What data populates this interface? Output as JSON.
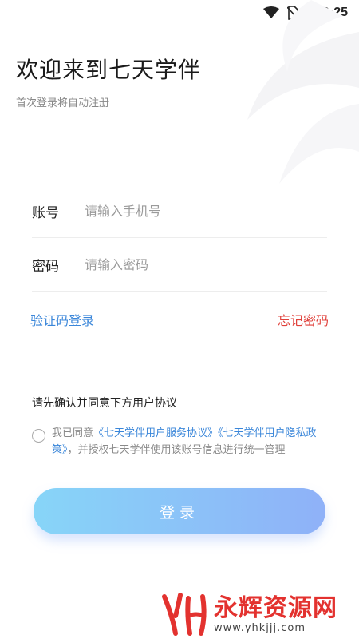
{
  "status_bar": {
    "time": "9:25",
    "icons": [
      "wifi-icon",
      "no-sim-icon",
      "battery-charging-icon"
    ]
  },
  "header": {
    "title": "欢迎来到七天学伴",
    "subtitle": "首次登录将自动注册"
  },
  "form": {
    "account": {
      "label": "账号",
      "placeholder": "请输入手机号",
      "value": ""
    },
    "password": {
      "label": "密码",
      "placeholder": "请输入密码",
      "value": ""
    }
  },
  "links": {
    "sms_login": "验证码登录",
    "forgot_password": "忘记密码"
  },
  "agreement": {
    "title": "请先确认并同意下方用户协议",
    "prefix": "我已同意",
    "service_link": "《七天学伴用户服务协议》",
    "privacy_link": "《七天学伴用户隐私政策》",
    "suffix": "，并授权七天学伴使用该账号信息进行统一管理",
    "checked": false
  },
  "login_button": {
    "label": "登录"
  },
  "watermark": {
    "name": "永辉资源网",
    "url": "www.yhkjjj.com"
  },
  "colors": {
    "link_blue": "#3a86d9",
    "forgot_red": "#e0413b",
    "button_start": "#87d5f8",
    "button_end": "#8fb1f8"
  }
}
